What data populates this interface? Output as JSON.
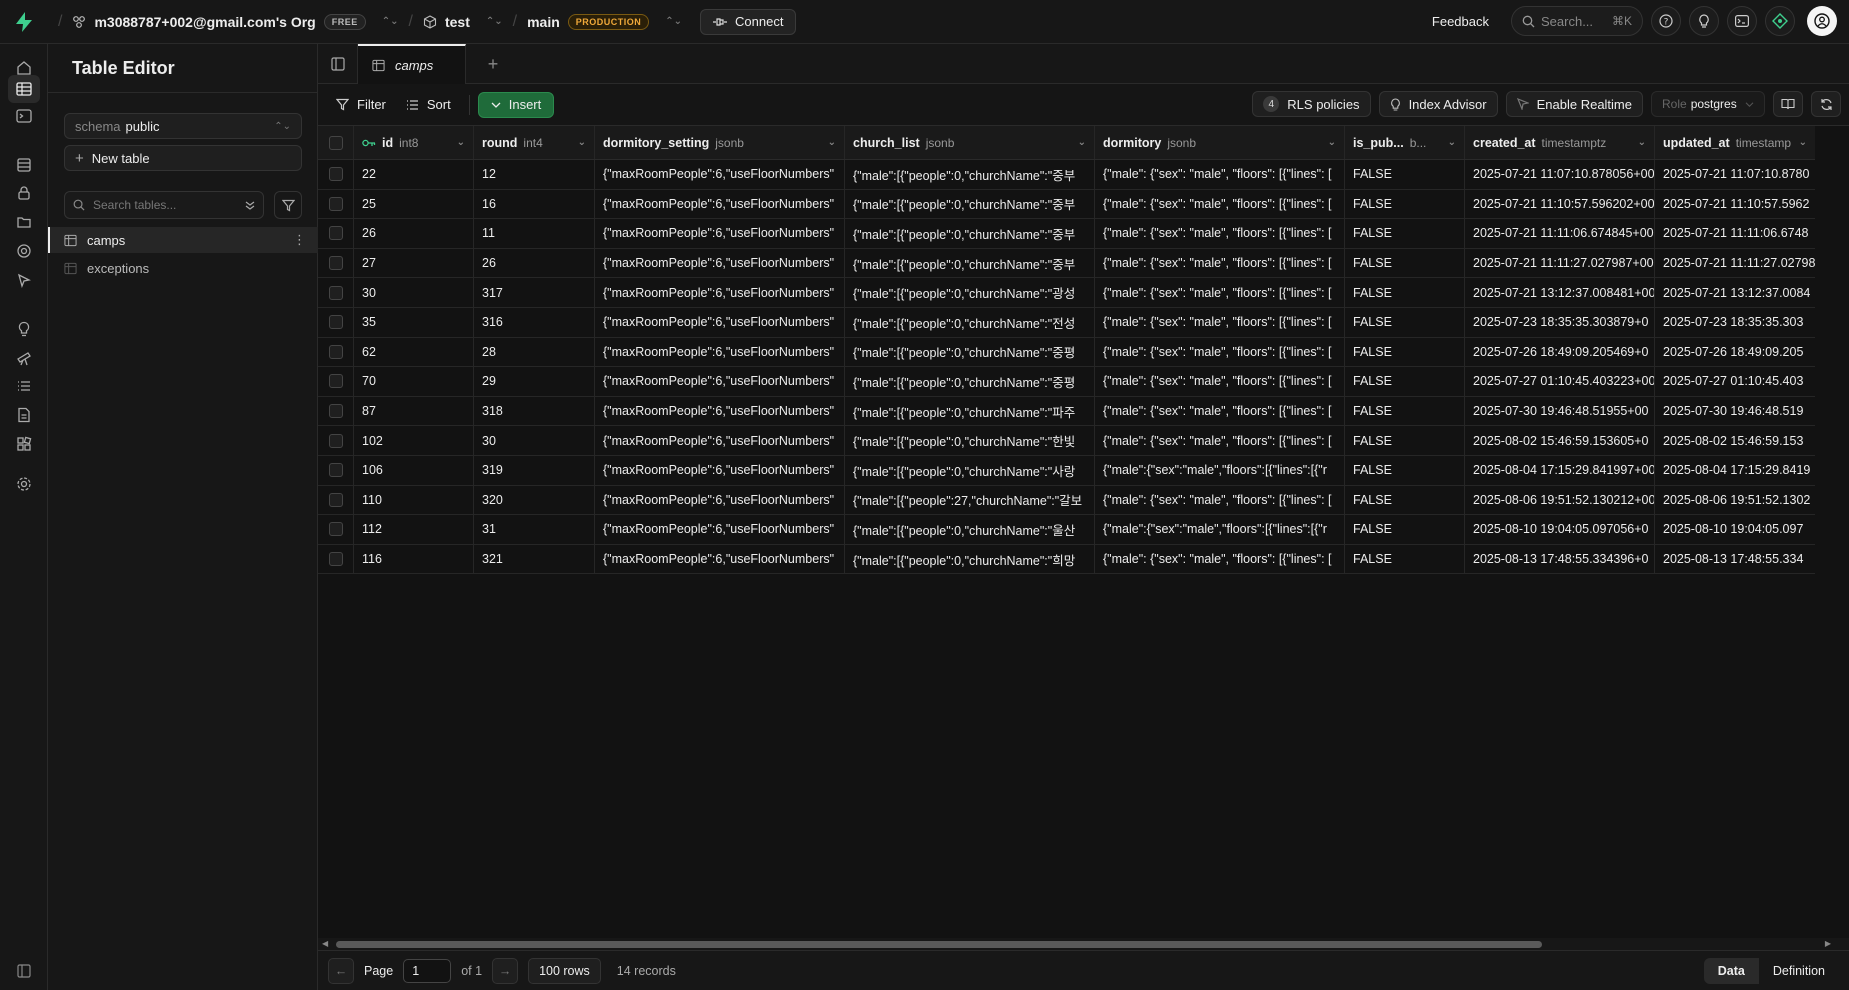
{
  "topbar": {
    "org": "m3088787+002@gmail.com's Org",
    "org_plan": "FREE",
    "project": "test",
    "branch": "main",
    "branch_env": "PRODUCTION",
    "connect_label": "Connect",
    "feedback_label": "Feedback",
    "search_placeholder": "Search...",
    "search_shortcut": "⌘K"
  },
  "sidebar": {
    "title": "Table Editor",
    "schema_label": "schema",
    "schema_value": "public",
    "new_table_label": "New table",
    "search_placeholder": "Search tables...",
    "tables": [
      {
        "name": "camps",
        "active": true
      },
      {
        "name": "exceptions",
        "active": false
      }
    ]
  },
  "tabs": [
    {
      "label": "camps"
    }
  ],
  "toolbar": {
    "filter_label": "Filter",
    "sort_label": "Sort",
    "insert_label": "Insert",
    "rls_count": "4",
    "rls_label": "RLS policies",
    "index_advisor_label": "Index Advisor",
    "realtime_label": "Enable Realtime",
    "role_label": "Role",
    "role_value": "postgres"
  },
  "columns": [
    {
      "name": "id",
      "type": "int8",
      "primary_key": true
    },
    {
      "name": "round",
      "type": "int4"
    },
    {
      "name": "dormitory_setting",
      "type": "jsonb"
    },
    {
      "name": "church_list",
      "type": "jsonb"
    },
    {
      "name": "dormitory",
      "type": "jsonb"
    },
    {
      "name": "is_pub...",
      "type": "b..."
    },
    {
      "name": "created_at",
      "type": "timestamptz"
    },
    {
      "name": "updated_at",
      "type": "timestamp"
    }
  ],
  "rows": [
    [
      "22",
      "12",
      "{\"maxRoomPeople\":6,\"useFloorNumbers\"",
      "{\"male\":[{\"people\":0,\"churchName\":\"중부",
      "{\"male\": {\"sex\": \"male\", \"floors\": [{\"lines\": [",
      "FALSE",
      "2025-07-21 11:07:10.878056+00",
      "2025-07-21 11:07:10.8780"
    ],
    [
      "25",
      "16",
      "{\"maxRoomPeople\":6,\"useFloorNumbers\"",
      "{\"male\":[{\"people\":0,\"churchName\":\"중부",
      "{\"male\": {\"sex\": \"male\", \"floors\": [{\"lines\": [",
      "FALSE",
      "2025-07-21 11:10:57.596202+00",
      "2025-07-21 11:10:57.5962"
    ],
    [
      "26",
      "11",
      "{\"maxRoomPeople\":6,\"useFloorNumbers\"",
      "{\"male\":[{\"people\":0,\"churchName\":\"중부",
      "{\"male\": {\"sex\": \"male\", \"floors\": [{\"lines\": [",
      "FALSE",
      "2025-07-21 11:11:06.674845+00",
      "2025-07-21 11:11:06.6748"
    ],
    [
      "27",
      "26",
      "{\"maxRoomPeople\":6,\"useFloorNumbers\"",
      "{\"male\":[{\"people\":0,\"churchName\":\"중부",
      "{\"male\": {\"sex\": \"male\", \"floors\": [{\"lines\": [",
      "FALSE",
      "2025-07-21 11:11:27.027987+00",
      "2025-07-21 11:11:27.02798"
    ],
    [
      "30",
      "317",
      "{\"maxRoomPeople\":6,\"useFloorNumbers\"",
      "{\"male\":[{\"people\":0,\"churchName\":\"광성",
      "{\"male\": {\"sex\": \"male\", \"floors\": [{\"lines\": [",
      "FALSE",
      "2025-07-21 13:12:37.008481+00",
      "2025-07-21 13:12:37.0084"
    ],
    [
      "35",
      "316",
      "{\"maxRoomPeople\":6,\"useFloorNumbers\"",
      "{\"male\":[{\"people\":0,\"churchName\":\"전성",
      "{\"male\": {\"sex\": \"male\", \"floors\": [{\"lines\": [",
      "FALSE",
      "2025-07-23 18:35:35.303879+0",
      "2025-07-23 18:35:35.303"
    ],
    [
      "62",
      "28",
      "{\"maxRoomPeople\":6,\"useFloorNumbers\"",
      "{\"male\":[{\"people\":0,\"churchName\":\"중평",
      "{\"male\": {\"sex\": \"male\", \"floors\": [{\"lines\": [",
      "FALSE",
      "2025-07-26 18:49:09.205469+0",
      "2025-07-26 18:49:09.205"
    ],
    [
      "70",
      "29",
      "{\"maxRoomPeople\":6,\"useFloorNumbers\"",
      "{\"male\":[{\"people\":0,\"churchName\":\"중평",
      "{\"male\": {\"sex\": \"male\", \"floors\": [{\"lines\": [",
      "FALSE",
      "2025-07-27 01:10:45.403223+00",
      "2025-07-27 01:10:45.403"
    ],
    [
      "87",
      "318",
      "{\"maxRoomPeople\":6,\"useFloorNumbers\"",
      "{\"male\":[{\"people\":0,\"churchName\":\"파주",
      "{\"male\": {\"sex\": \"male\", \"floors\": [{\"lines\": [",
      "FALSE",
      "2025-07-30 19:46:48.51955+00",
      "2025-07-30 19:46:48.519"
    ],
    [
      "102",
      "30",
      "{\"maxRoomPeople\":6,\"useFloorNumbers\"",
      "{\"male\":[{\"people\":0,\"churchName\":\"한빛",
      "{\"male\": {\"sex\": \"male\", \"floors\": [{\"lines\": [",
      "FALSE",
      "2025-08-02 15:46:59.153605+0",
      "2025-08-02 15:46:59.153"
    ],
    [
      "106",
      "319",
      "{\"maxRoomPeople\":6,\"useFloorNumbers\"",
      "{\"male\":[{\"people\":0,\"churchName\":\"사랑",
      "{\"male\":{\"sex\":\"male\",\"floors\":[{\"lines\":[{\"r",
      "FALSE",
      "2025-08-04 17:15:29.841997+00",
      "2025-08-04 17:15:29.8419"
    ],
    [
      "110",
      "320",
      "{\"maxRoomPeople\":6,\"useFloorNumbers\"",
      "{\"male\":[{\"people\":27,\"churchName\":\"갈보",
      "{\"male\": {\"sex\": \"male\", \"floors\": [{\"lines\": [",
      "FALSE",
      "2025-08-06 19:51:52.130212+00",
      "2025-08-06 19:51:52.1302"
    ],
    [
      "112",
      "31",
      "{\"maxRoomPeople\":6,\"useFloorNumbers\"",
      "{\"male\":[{\"people\":0,\"churchName\":\"울산",
      "{\"male\":{\"sex\":\"male\",\"floors\":[{\"lines\":[{\"r",
      "FALSE",
      "2025-08-10 19:04:05.097056+0",
      "2025-08-10 19:04:05.097"
    ],
    [
      "116",
      "321",
      "{\"maxRoomPeople\":6,\"useFloorNumbers\"",
      "{\"male\":[{\"people\":0,\"churchName\":\"희망",
      "{\"male\": {\"sex\": \"male\", \"floors\": [{\"lines\": [",
      "FALSE",
      "2025-08-13 17:48:55.334396+0",
      "2025-08-13 17:48:55.334"
    ]
  ],
  "footer": {
    "page_label": "Page",
    "page_value": "1",
    "of_label": "of 1",
    "rows_label": "100 rows",
    "records_label": "14 records",
    "data_label": "Data",
    "definition_label": "Definition"
  },
  "colors": {
    "brand": "#3ecf8e",
    "insert": "#1f6b3a",
    "production": "#f0a93a"
  }
}
